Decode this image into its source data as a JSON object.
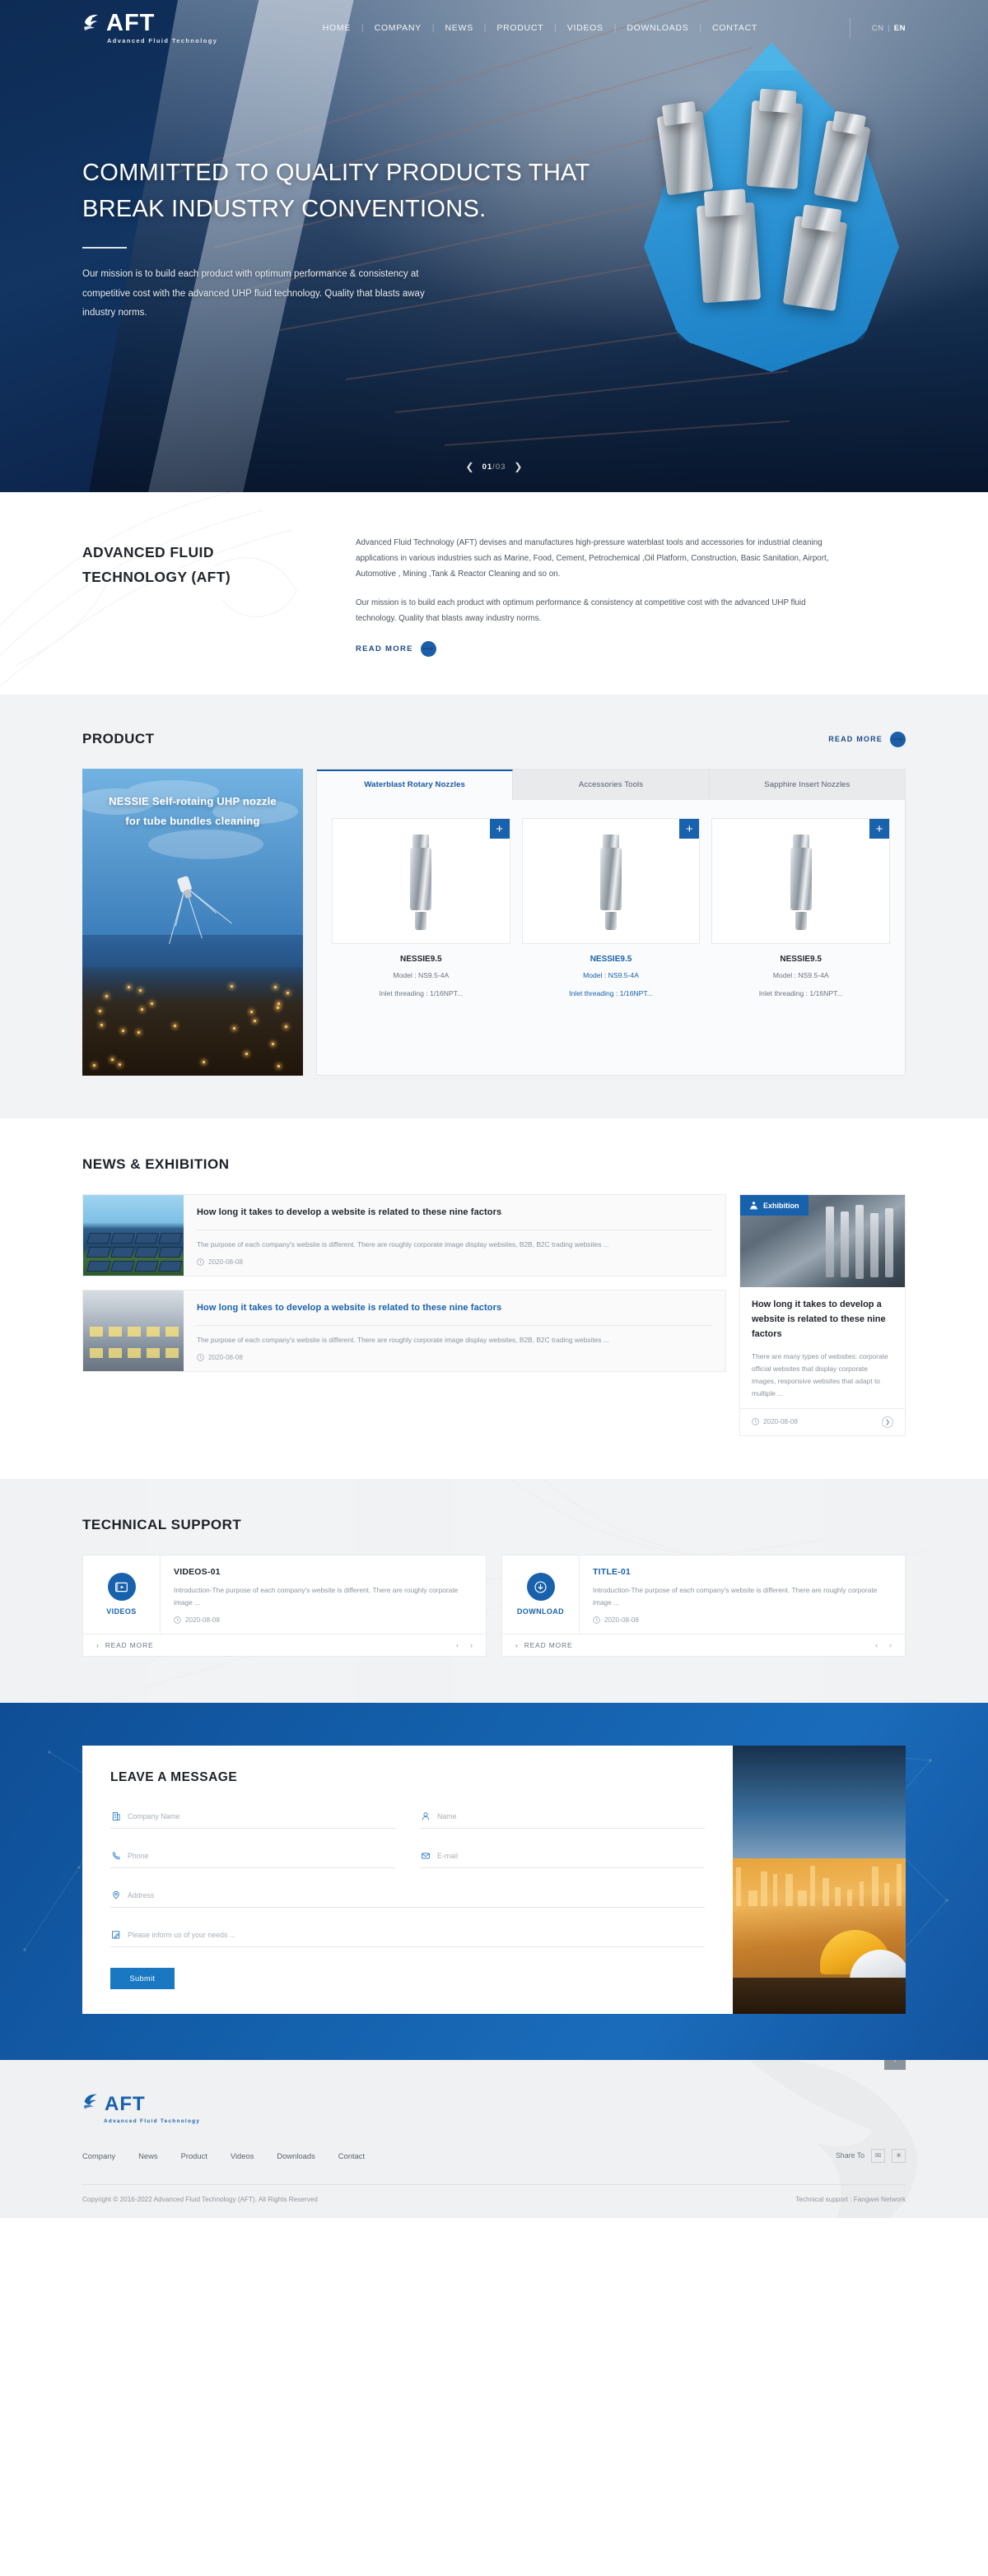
{
  "brand": {
    "name": "AFT",
    "tagline": "Advanced Fluid Technology"
  },
  "nav": {
    "items": [
      {
        "label": "HOME"
      },
      {
        "label": "COMPANY"
      },
      {
        "label": "NEWS"
      },
      {
        "label": "PRODUCT"
      },
      {
        "label": "VIDEOS"
      },
      {
        "label": "DOWNLOADS"
      },
      {
        "label": "CONTACT"
      }
    ],
    "lang_cn": "CN",
    "lang_divider": "|",
    "lang_en": "EN"
  },
  "hero": {
    "headline_line1": "COMMITTED TO QUALITY PRODUCTS THAT",
    "headline_line2": "BREAK INDUSTRY CONVENTIONS.",
    "paragraph": "Our mission is to build each product with optimum performance & consistency at competitive cost with the advanced UHP fluid technology. Quality that blasts away industry norms.",
    "prev_icon": "chevron-left",
    "next_icon": "chevron-right",
    "page_current": "01",
    "page_sep": "/",
    "page_total": "03"
  },
  "about": {
    "title": "ADVANCED FLUID TECHNOLOGY (AFT)",
    "paragraph1": "Advanced Fluid Technology (AFT) devises and manufactures high-pressure waterblast tools and accessories for industrial cleaning applications in various industries such as Marine, Food, Cement, Petrochemical ,Oil Platform, Construction, Basic Sanitation, Airport, Automotive , Mining ,Tank & Reactor Cleaning and so on.",
    "paragraph2": "Our mission is to build each product with optimum performance & consistency at competitive cost with the advanced UHP fluid technology. Quality that blasts away industry norms.",
    "read_more": "READ  MORE",
    "arrow_icon": "arrow-right-icon"
  },
  "product": {
    "section_title": "PRODUCT",
    "read_more": "READ  MORE",
    "promo_line1": "NESSIE Self-rotaing UHP nozzle",
    "promo_line2": "for tube bundles cleaning",
    "tabs": [
      {
        "label": "Waterblast Rotary Nozzles",
        "active": true
      },
      {
        "label": "Accessories Tools",
        "active": false
      },
      {
        "label": "Sapphire Insert Nozzles",
        "active": false
      }
    ],
    "cards": [
      {
        "name": "NESSIE9.5",
        "model": "Model : NS9.5-4A",
        "inlet": "Inlet threading : 1/16NPT...",
        "plus": "+"
      },
      {
        "name": "NESSIE9.5",
        "model": "Model : NS9.5-4A",
        "inlet": "Inlet threading : 1/16NPT...",
        "plus": "+"
      },
      {
        "name": "NESSIE9.5",
        "model": "Model : NS9.5-4A",
        "inlet": "Inlet threading : 1/16NPT...",
        "plus": "+"
      }
    ]
  },
  "news": {
    "section_title": "NEWS & EXHIBITION",
    "items": [
      {
        "title": "How long it takes to develop a website is related to these nine factors",
        "desc": "The purpose of each company's website is different. There are roughly corporate image display websites, B2B, B2C trading websites  ...",
        "date": "2020-08-08",
        "clock_icon": "clock-icon"
      },
      {
        "title": "How long it takes to develop a website is related to these nine factors",
        "desc": "The purpose of each company's website is different. There are roughly corporate image display websites, B2B, B2C trading websites  ...",
        "date": "2020-08-08",
        "clock_icon": "clock-icon"
      }
    ],
    "exhibition": {
      "badge": "Exhibition",
      "badge_icon": "exhibition-icon",
      "title": "How long it takes to develop a website is related to these nine factors",
      "desc": "There are many types of websites: corporate official websites that display corporate images, responsive websites that adapt to multiple ...",
      "date": "2020-08-08",
      "clock_icon": "clock-icon",
      "arrow_icon": "chevron-right-icon"
    }
  },
  "tech": {
    "section_title": "TECHNICAL SUPPORT",
    "cards": [
      {
        "label": "VIDEOS",
        "icon": "video-icon",
        "title": "VIDEOS-01",
        "title_color": "dark",
        "desc": "Introduction-The purpose of each company's website is different. There are roughly corporate image  ...",
        "date": "2020-08-08",
        "read_more": "READ  MORE",
        "prev": "‹",
        "next": "›"
      },
      {
        "label": "DOWNLOAD",
        "icon": "download-icon",
        "title": "TITLE-01",
        "title_color": "blue",
        "desc": "Introduction-The purpose of each company's website is different. There are roughly corporate image  ...",
        "date": "2020-08-08",
        "read_more": "READ  MORE",
        "prev": "‹",
        "next": "›"
      }
    ]
  },
  "message": {
    "title": "LEAVE A MESSAGE",
    "fields": [
      {
        "name": "company",
        "placeholder": "Company Name",
        "value": "",
        "icon": "building-icon"
      },
      {
        "name": "name",
        "placeholder": "Name",
        "value": "",
        "icon": "user-icon"
      },
      {
        "name": "phone",
        "placeholder": "Phone",
        "value": "",
        "icon": "phone-icon"
      },
      {
        "name": "email",
        "placeholder": "E-mail",
        "value": "",
        "icon": "mail-icon"
      },
      {
        "name": "address",
        "placeholder": "Address",
        "value": "",
        "icon": "location-icon"
      },
      {
        "name": "needs",
        "placeholder": "Please inform us of your needs ...",
        "value": "",
        "icon": "pencil-icon"
      }
    ],
    "submit": "Submit"
  },
  "footer": {
    "links": [
      {
        "label": "Company"
      },
      {
        "label": "News"
      },
      {
        "label": "Product"
      },
      {
        "label": "Videos"
      },
      {
        "label": "Downloads"
      },
      {
        "label": "Contact"
      }
    ],
    "share_label": "Share To",
    "share_icons": [
      "wechat-icon",
      "weibo-icon"
    ],
    "copyright": "Copyright © 2016-2022 Advanced Fluid Technology (AFT). All Rights Reserved",
    "tech_support": "Technical support : Fangwei Network",
    "back_to_top_icon": "arrow-up-icon"
  },
  "colors": {
    "brand_blue": "#1861ad",
    "deep_navy": "#0d2b55",
    "accent_cyan": "#4db4e8"
  }
}
